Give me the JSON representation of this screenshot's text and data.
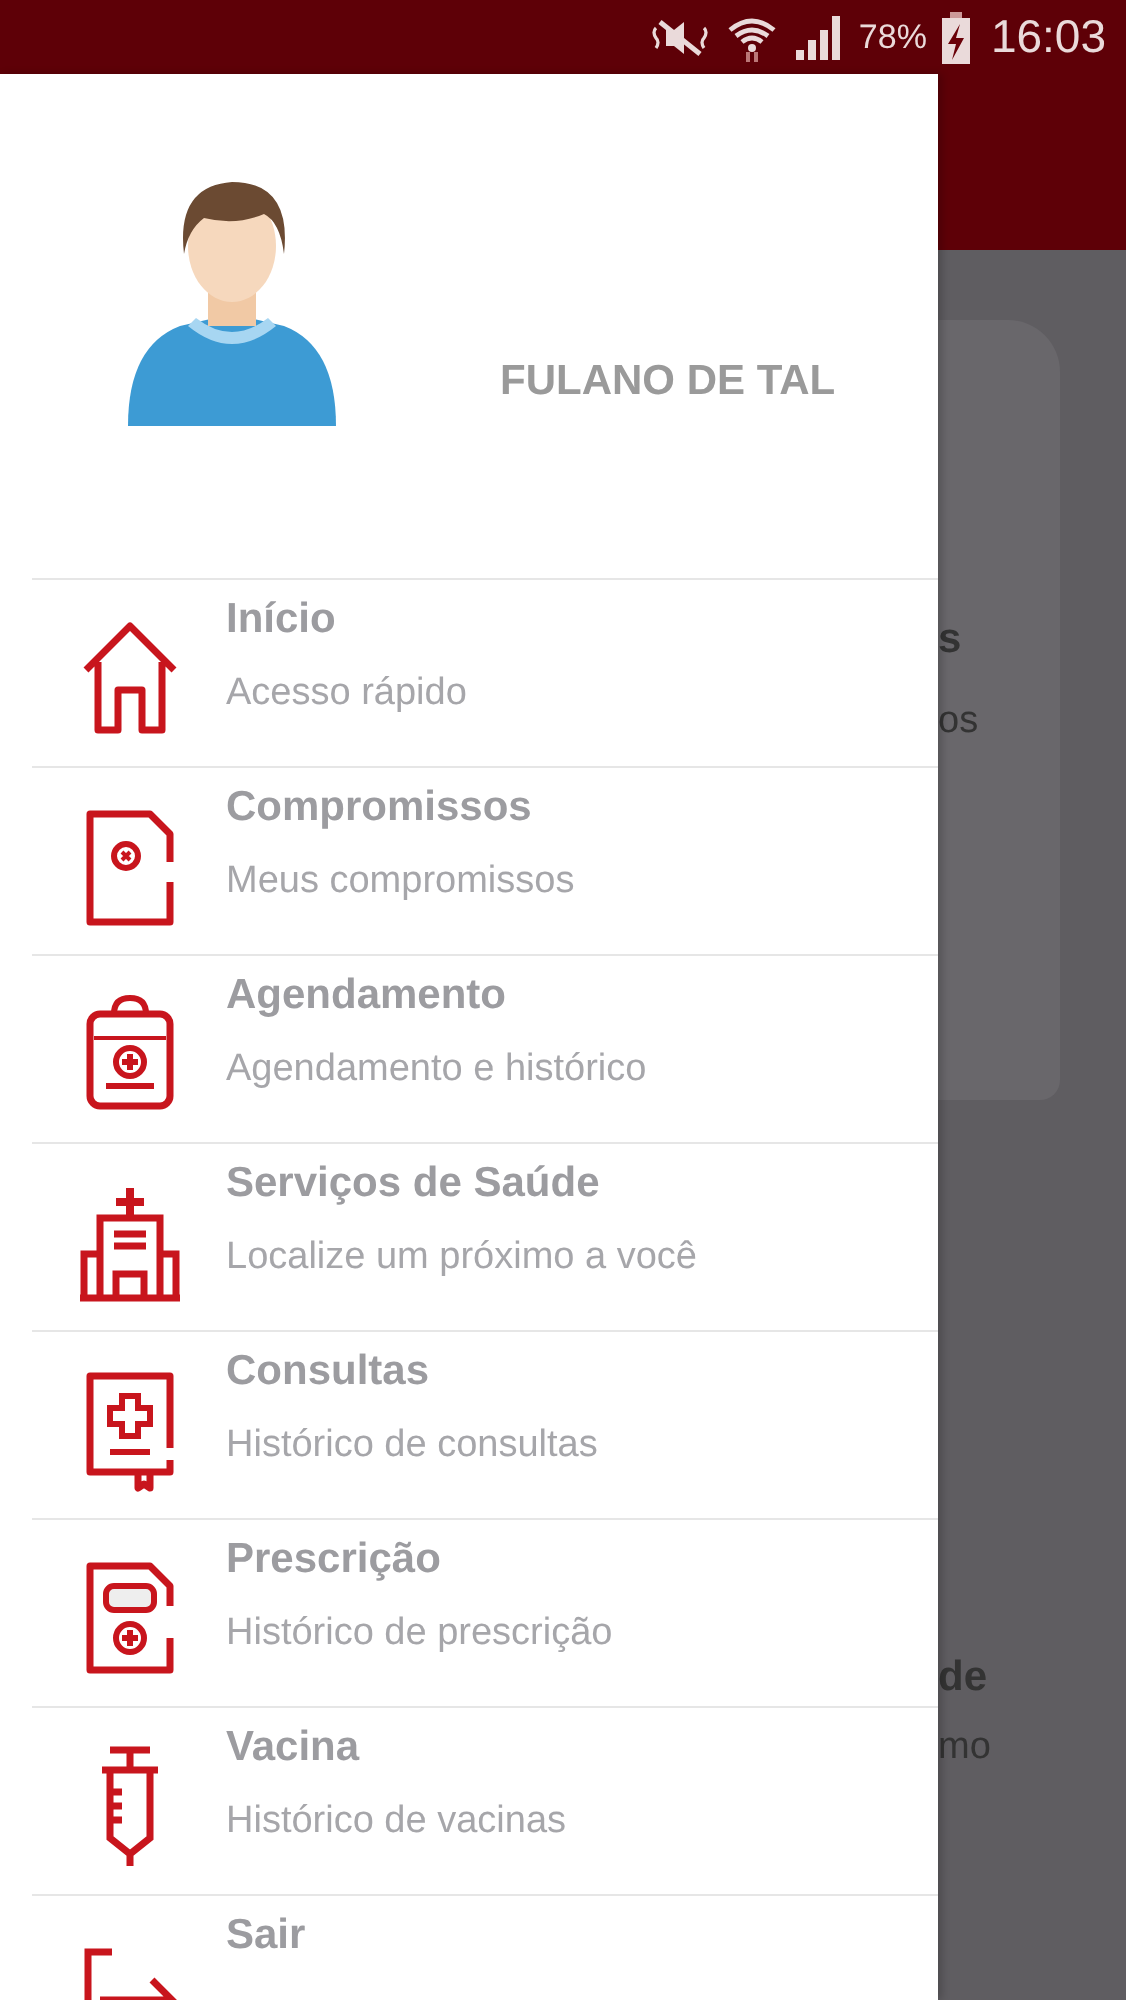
{
  "status_bar": {
    "battery": "78%",
    "time": "16:03"
  },
  "background": {
    "cards": [
      {
        "texts": [
          {
            "text": "s",
            "kind": "title"
          },
          {
            "text": "os",
            "kind": "subtitle"
          }
        ]
      },
      {
        "texts": [
          {
            "text": "de",
            "kind": "title"
          },
          {
            "text": "mo",
            "kind": "subtitle"
          }
        ]
      }
    ]
  },
  "drawer": {
    "user_name": "FULANO DE TAL",
    "items": [
      {
        "title": "Início",
        "subtitle": "Acesso rápido"
      },
      {
        "title": "Compromissos",
        "subtitle": "Meus compromissos"
      },
      {
        "title": "Agendamento",
        "subtitle": "Agendamento e histórico"
      },
      {
        "title": "Serviços de Saúde",
        "subtitle": "Localize um próximo a você"
      },
      {
        "title": "Consultas",
        "subtitle": "Histórico de consultas"
      },
      {
        "title": "Prescrição",
        "subtitle": "Histórico de prescrição"
      },
      {
        "title": "Vacina",
        "subtitle": "Histórico de vacinas"
      },
      {
        "title": "Sair"
      }
    ]
  }
}
